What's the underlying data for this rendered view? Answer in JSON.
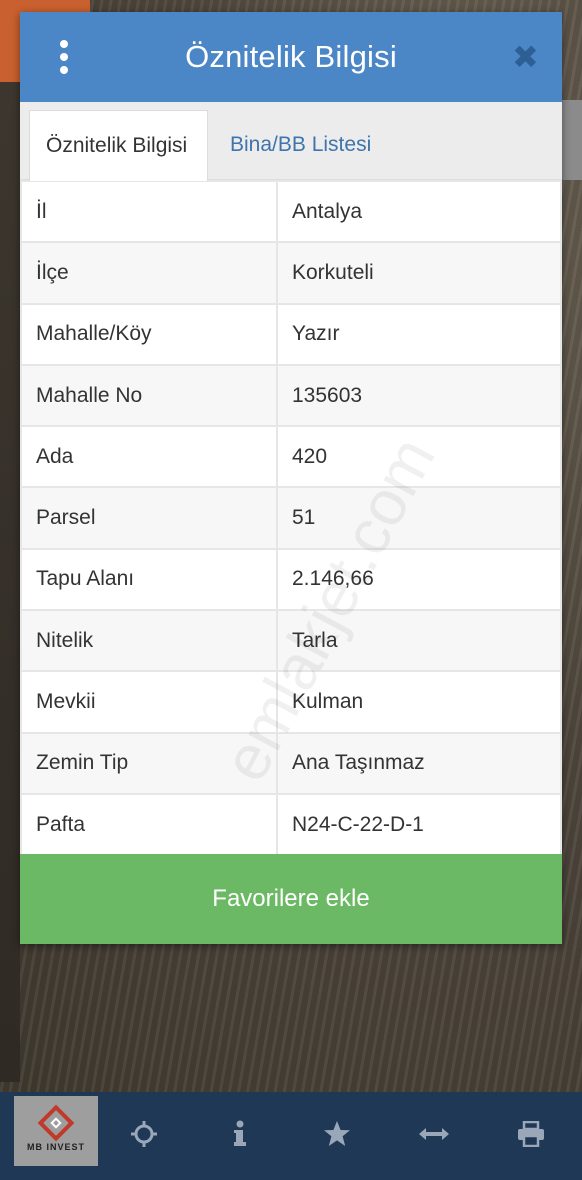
{
  "panel": {
    "title": "Öznitelik Bilgisi"
  },
  "tabs": [
    {
      "label": "Öznitelik Bilgisi",
      "active": true
    },
    {
      "label": "Bina/BB Listesi",
      "active": false
    }
  ],
  "attributes": [
    {
      "key": "İl",
      "value": "Antalya"
    },
    {
      "key": "İlçe",
      "value": "Korkuteli"
    },
    {
      "key": "Mahalle/Köy",
      "value": "Yazır"
    },
    {
      "key": "Mahalle No",
      "value": "135603"
    },
    {
      "key": "Ada",
      "value": "420"
    },
    {
      "key": "Parsel",
      "value": "51"
    },
    {
      "key": "Tapu Alanı",
      "value": "2.146,66"
    },
    {
      "key": "Nitelik",
      "value": "Tarla"
    },
    {
      "key": "Mevkii",
      "value": "Kulman"
    },
    {
      "key": "Zemin Tip",
      "value": "Ana Taşınmaz"
    },
    {
      "key": "Pafta",
      "value": "N24-C-22-D-1"
    }
  ],
  "actions": {
    "favorite_label": "Favorilere ekle"
  },
  "watermark": "emlakjet.com",
  "logo": {
    "text": "MB INVEST"
  },
  "toolbar": {
    "icons": [
      "locate-icon",
      "info-icon",
      "star-icon",
      "measure-icon",
      "print-icon"
    ]
  },
  "colors": {
    "header": "#4b86c6",
    "favorite_button": "#6cb965",
    "bottom_bar": "#1f3856",
    "tab_link": "#3f74ac"
  }
}
